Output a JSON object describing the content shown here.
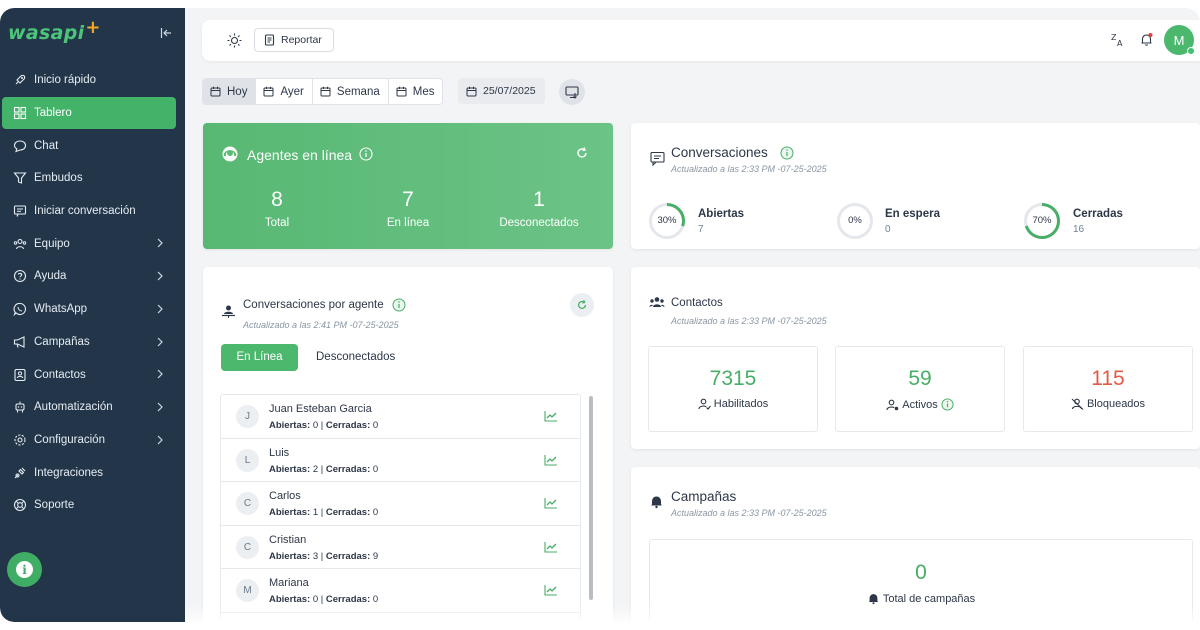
{
  "app": {
    "logo_text": "wasapi",
    "logo_plus": "+",
    "brand_green": "#44b36a",
    "sidebar_bg": "#233649"
  },
  "sidebar": {
    "items": [
      {
        "label": "Inicio rápido",
        "icon": "rocket-icon",
        "active": false,
        "has_children": false
      },
      {
        "label": "Tablero",
        "icon": "dashboard-icon",
        "active": true,
        "has_children": false
      },
      {
        "label": "Chat",
        "icon": "chat-bubble-icon",
        "active": false,
        "has_children": false
      },
      {
        "label": "Embudos",
        "icon": "funnel-icon",
        "active": false,
        "has_children": false
      },
      {
        "label": "Iniciar conversación",
        "icon": "new-message-icon",
        "active": false,
        "has_children": false
      },
      {
        "label": "Equipo",
        "icon": "team-icon",
        "active": false,
        "has_children": true
      },
      {
        "label": "Ayuda",
        "icon": "help-icon",
        "active": false,
        "has_children": true
      },
      {
        "label": "WhatsApp",
        "icon": "whatsapp-icon",
        "active": false,
        "has_children": true
      },
      {
        "label": "Campañas",
        "icon": "megaphone-icon",
        "active": false,
        "has_children": true
      },
      {
        "label": "Contactos",
        "icon": "contacts-icon",
        "active": false,
        "has_children": true
      },
      {
        "label": "Automatización",
        "icon": "robot-icon",
        "active": false,
        "has_children": true
      },
      {
        "label": "Configuración",
        "icon": "gear-icon",
        "active": false,
        "has_children": true
      },
      {
        "label": "Integraciones",
        "icon": "plug-icon",
        "active": false,
        "has_children": false
      },
      {
        "label": "Soporte",
        "icon": "lifebuoy-icon",
        "active": false,
        "has_children": false
      }
    ]
  },
  "topbar": {
    "report_label": "Reportar",
    "avatar_initial": "M"
  },
  "filters": {
    "today": "Hoy",
    "yesterday": "Ayer",
    "week": "Semana",
    "month": "Mes",
    "date": "25/07/2025"
  },
  "agents_card": {
    "title": "Agentes en línea",
    "total_value": "8",
    "total_label": "Total",
    "online_value": "7",
    "online_label": "En línea",
    "offline_value": "1",
    "offline_label": "Desconectados"
  },
  "conversations_card": {
    "title": "Conversaciones",
    "updated": "Actualizado a las 2:33 PM -07-25-2025",
    "open": {
      "pct_label": "30%",
      "pct": 0.3,
      "title": "Abiertas",
      "value": "7"
    },
    "waiting": {
      "pct_label": "0%",
      "pct": 0.0,
      "title": "En espera",
      "value": "0"
    },
    "closed": {
      "pct_label": "70%",
      "pct": 0.7,
      "title": "Cerradas",
      "value": "16"
    }
  },
  "agent_conversations": {
    "title": "Conversaciones por agente",
    "updated": "Actualizado a las 2:41 PM -07-25-2025",
    "tab_online": "En Línea",
    "tab_offline": "Desconectados",
    "open_label": "Abiertas:",
    "closed_label": "Cerradas:",
    "rows": [
      {
        "initial": "J",
        "name": "Juan Esteban Garcia",
        "open": "0",
        "closed": "0"
      },
      {
        "initial": "L",
        "name": "Luis",
        "open": "2",
        "closed": "0"
      },
      {
        "initial": "C",
        "name": "Carlos",
        "open": "1",
        "closed": "0"
      },
      {
        "initial": "C",
        "name": "Cristian",
        "open": "3",
        "closed": "9"
      },
      {
        "initial": "M",
        "name": "Mariana",
        "open": "0",
        "closed": "0"
      }
    ]
  },
  "contacts_card": {
    "title": "Contactos",
    "updated": "Actualizado a las 2:33 PM -07-25-2025",
    "enabled": {
      "value": "7315",
      "label": "Habilitados",
      "color": "#48ae67"
    },
    "active": {
      "value": "59",
      "label": "Activos",
      "color": "#48ae67"
    },
    "blocked": {
      "value": "115",
      "label": "Bloqueados",
      "color": "#e05a45"
    }
  },
  "campaigns_card": {
    "title": "Campañas",
    "updated": "Actualizado a las 2:33 PM -07-25-2025",
    "total_value": "0",
    "total_label": "Total de campañas"
  }
}
